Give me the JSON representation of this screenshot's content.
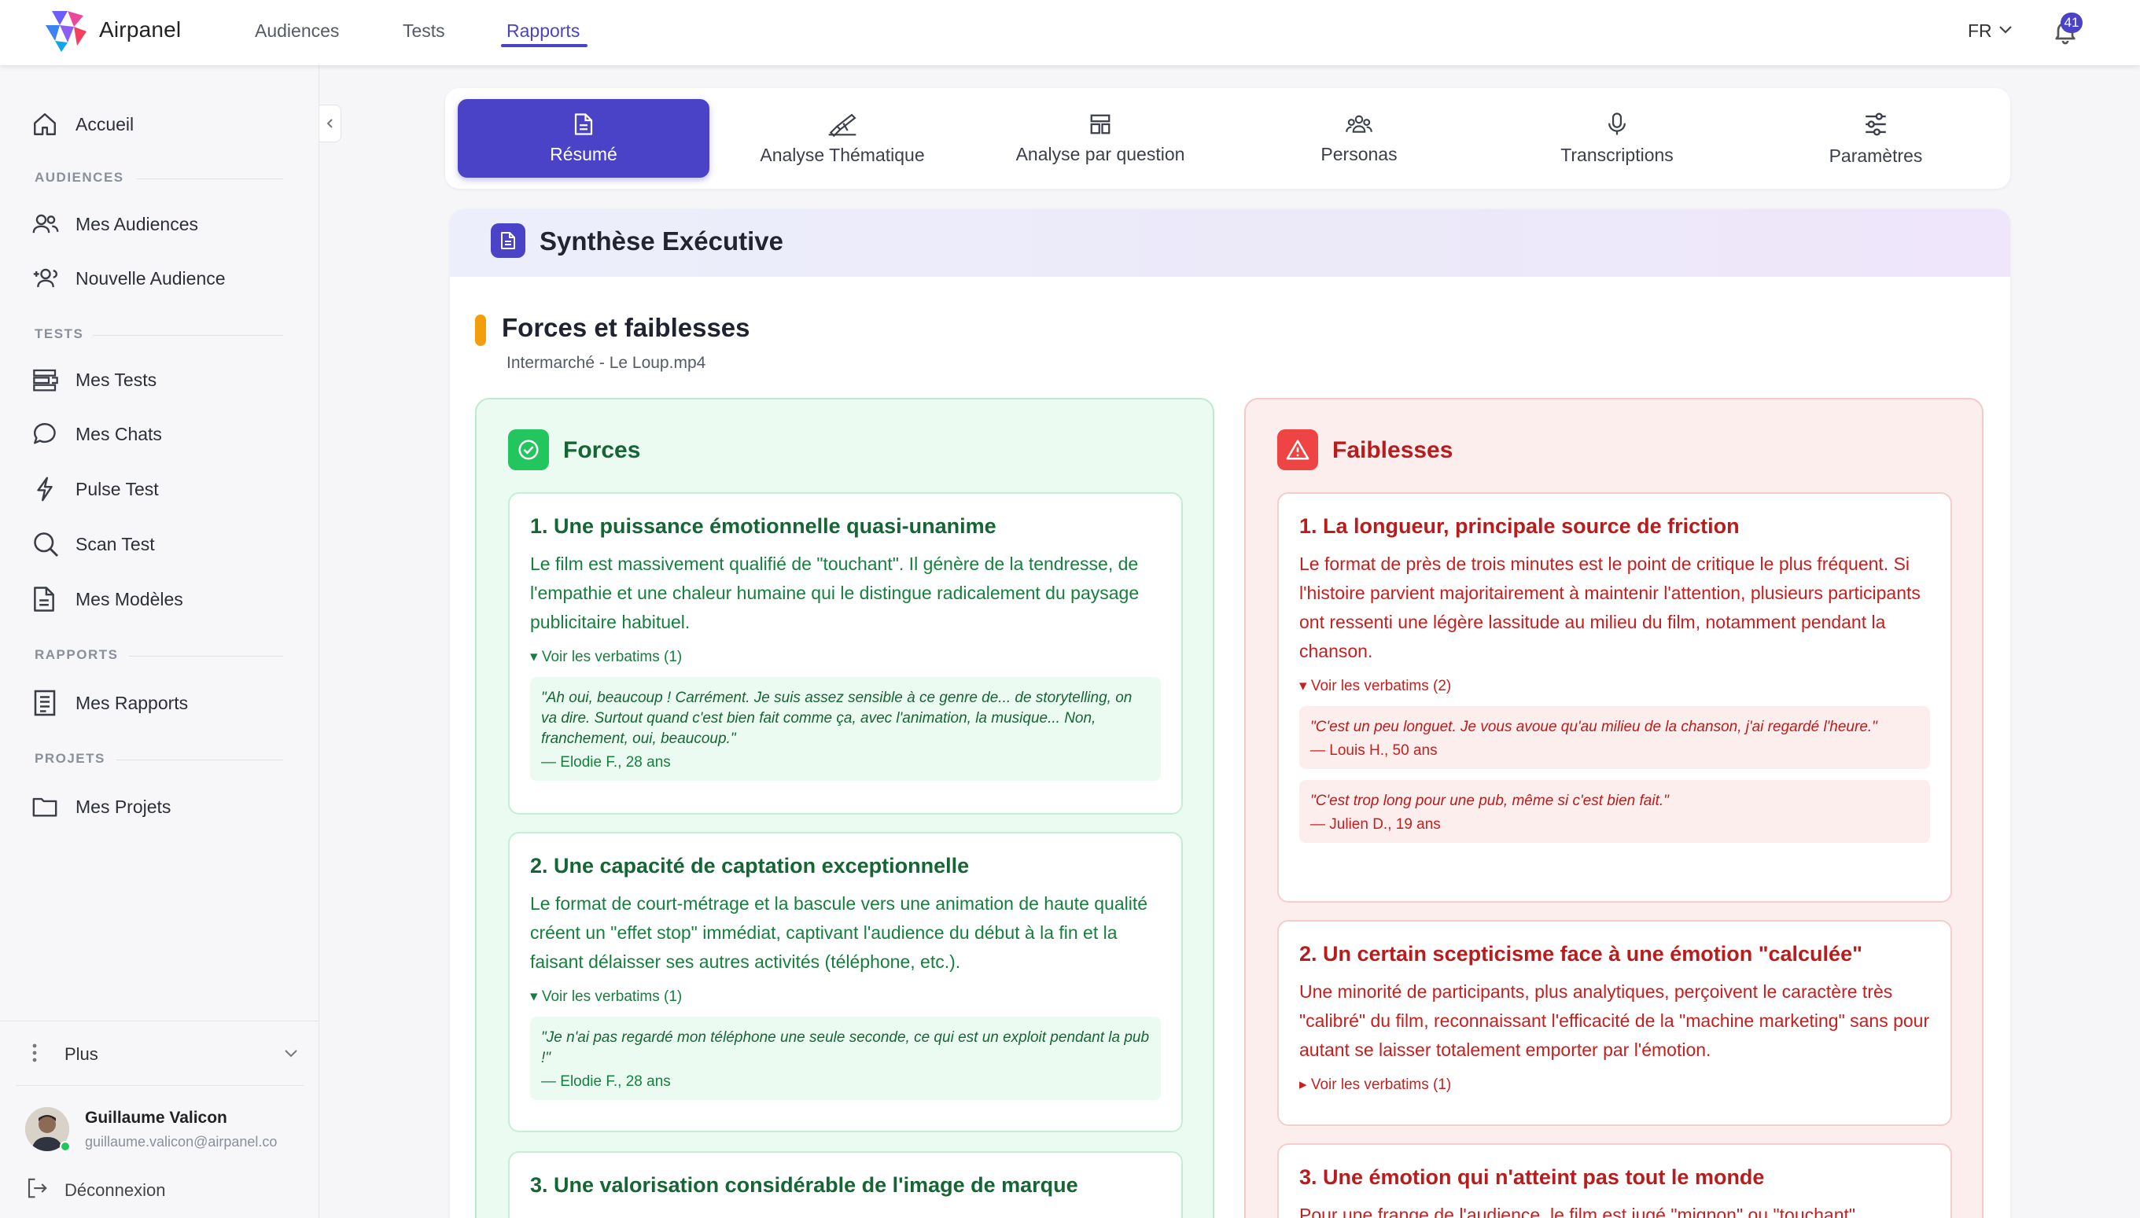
{
  "app": {
    "name": "Airpanel"
  },
  "topnav": {
    "items": [
      {
        "label": "Audiences"
      },
      {
        "label": "Tests"
      },
      {
        "label": "Rapports"
      }
    ],
    "active": "Rapports",
    "language": "FR",
    "notifications": "41"
  },
  "sidebar": {
    "home": "Accueil",
    "sections": {
      "audiences": "AUDIENCES",
      "tests": "TESTS",
      "rapports": "RAPPORTS",
      "projets": "PROJETS"
    },
    "items": {
      "mes_audiences": "Mes Audiences",
      "nouvelle_audience": "Nouvelle Audience",
      "mes_tests": "Mes Tests",
      "mes_chats": "Mes Chats",
      "pulse_test": "Pulse Test",
      "scan_test": "Scan Test",
      "mes_modeles": "Mes Modèles",
      "mes_rapports": "Mes Rapports",
      "mes_projets": "Mes Projets"
    },
    "plus": "Plus",
    "user": {
      "name": "Guillaume Valicon",
      "email": "guillaume.valicon@airpanel.co"
    },
    "logout": "Déconnexion"
  },
  "tabs": [
    {
      "label": "Résumé",
      "icon": "document-icon",
      "active": true
    },
    {
      "label": "Analyse Thématique",
      "icon": "pen-icon",
      "active": false
    },
    {
      "label": "Analyse par question",
      "icon": "layout-icon",
      "active": false
    },
    {
      "label": "Personas",
      "icon": "people-icon",
      "active": false
    },
    {
      "label": "Transcriptions",
      "icon": "microphone-icon",
      "active": false
    },
    {
      "label": "Paramètres",
      "icon": "sliders-icon",
      "active": false
    }
  ],
  "report": {
    "title": "Synthèse Exécutive",
    "section_title": "Forces et faiblesses",
    "section_subtitle": "Intermarché - Le Loup.mp4",
    "forces": {
      "title": "Forces",
      "items": [
        {
          "title": "1. Une puissance émotionnelle quasi-unanime",
          "text": "Le film est massivement qualifié de \"touchant\". Il génère de la tendresse, de l'empathie et une chaleur humaine qui le distingue radicalement du paysage publicitaire habituel.",
          "toggle": "▾ Voir les verbatims (1)",
          "quotes": [
            {
              "text": "\"Ah oui, beaucoup ! Carrément. Je suis assez sensible à ce genre de... de storytelling, on va dire. Surtout quand c'est bien fait comme ça, avec l'animation, la musique... Non, franchement, oui, beaucoup.\"",
              "author": "— Elodie F., 28 ans"
            }
          ]
        },
        {
          "title": "2. Une capacité de captation exceptionnelle",
          "text": "Le format de court-métrage et la bascule vers une animation de haute qualité créent un \"effet stop\" immédiat, captivant l'audience du début à la fin et la faisant délaisser ses autres activités (téléphone, etc.).",
          "toggle": "▾ Voir les verbatims (1)",
          "quotes": [
            {
              "text": "\"Je n'ai pas regardé mon téléphone une seule seconde, ce qui est un exploit pendant la pub !\"",
              "author": "— Elodie F., 28 ans"
            }
          ]
        },
        {
          "title": "3. Une valorisation considérable de l'image de marque",
          "text": ""
        }
      ]
    },
    "faiblesses": {
      "title": "Faiblesses",
      "items": [
        {
          "title": "1. La longueur, principale source de friction",
          "text": "Le format de près de trois minutes est le point de critique le plus fréquent. Si l'histoire parvient majoritairement à maintenir l'attention, plusieurs participants ont ressenti une légère lassitude au milieu du film, notamment pendant la chanson.",
          "toggle": "▾ Voir les verbatims (2)",
          "quotes": [
            {
              "text": "\"C'est un peu longuet. Je vous avoue qu'au milieu de la chanson, j'ai regardé l'heure.\"",
              "author": "— Louis H., 50 ans"
            },
            {
              "text": "\"C'est trop long pour une pub, même si c'est bien fait.\"",
              "author": "— Julien D., 19 ans"
            }
          ]
        },
        {
          "title": "2. Un certain scepticisme face à une émotion \"calculée\"",
          "text": "Une minorité de participants, plus analytiques, perçoivent le caractère très \"calibré\" du film, reconnaissant l'efficacité de la \"machine marketing\" sans pour autant se laisser totalement emporter par l'émotion.",
          "toggle": "▸ Voir les verbatims (1)"
        },
        {
          "title": "3. Une émotion qui n'atteint pas tout le monde",
          "text": "Pour une frange de l'audience, le film est jugé \"mignon\" ou \"touchant\""
        }
      ]
    }
  },
  "colors": {
    "accent": "#4a43c8",
    "positive": "#22c55e",
    "negative": "#ef4444",
    "section_marker": "#f59e0b"
  }
}
